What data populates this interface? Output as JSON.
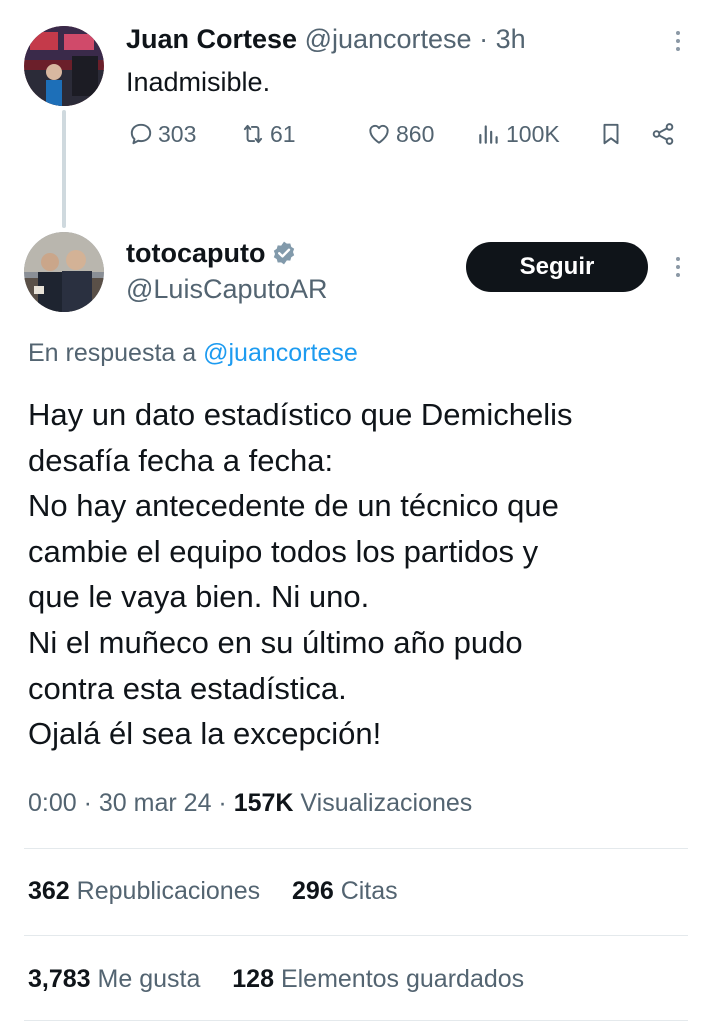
{
  "parent": {
    "author_name": "Juan Cortese",
    "handle": "@juancortese",
    "separator": "·",
    "time": "3h",
    "text": "Inadmisible.",
    "actions": {
      "replies": "303",
      "reposts": "61",
      "likes": "860",
      "views": "100K"
    }
  },
  "reply": {
    "author_name": "totocaputo",
    "handle": "@LuisCaputoAR",
    "follow_label": "Seguir",
    "in_reply_prefix": "En respuesta a",
    "in_reply_handle": "@juancortese",
    "text_lines": [
      "Hay un dato estadístico que Demichelis",
      "desafía fecha a fecha:",
      "No hay antecedente de un técnico que",
      "cambie el equipo todos los partidos y",
      "que le vaya bien. Ni uno.",
      "Ni el muñeco en su último año pudo",
      "contra esta estadística.",
      "Ojalá él sea la excepción!"
    ],
    "meta": {
      "time": "0:00",
      "sep1": "·",
      "date": "30 mar 24",
      "sep2": "·",
      "views_count": "157K",
      "views_label": "Visualizaciones"
    },
    "stats": {
      "reposts_count": "362",
      "reposts_label": "Republicaciones",
      "quotes_count": "296",
      "quotes_label": "Citas",
      "likes_count": "3,783",
      "likes_label": "Me gusta",
      "bookmarks_count": "128",
      "bookmarks_label": "Elementos guardados"
    }
  },
  "icons": {
    "reply": "reply-icon",
    "repost": "repost-icon",
    "like": "heart-icon",
    "views": "views-chart-icon",
    "bookmark": "bookmark-icon",
    "share": "share-icon",
    "verified": "verified-badge-icon",
    "more": "more-vertical-icon"
  },
  "colors": {
    "text": "#0f1419",
    "muted": "#536471",
    "link": "#1d9bf0",
    "verified": "#829aab",
    "button_bg": "#0f1419",
    "thread_line": "#cfd9de"
  }
}
